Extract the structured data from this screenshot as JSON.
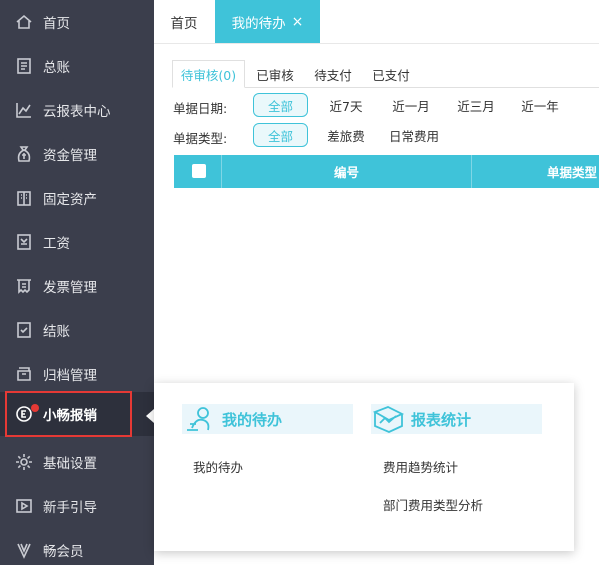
{
  "sidebar": {
    "items": [
      {
        "label": "首页",
        "icon": "home-icon"
      },
      {
        "label": "总账",
        "icon": "ledger-icon"
      },
      {
        "label": "云报表中心",
        "icon": "chart-icon"
      },
      {
        "label": "资金管理",
        "icon": "money-bag-icon"
      },
      {
        "label": "固定资产",
        "icon": "building-icon"
      },
      {
        "label": "工资",
        "icon": "salary-icon"
      },
      {
        "label": "发票管理",
        "icon": "invoice-icon"
      },
      {
        "label": "结账",
        "icon": "checkout-icon"
      },
      {
        "label": "归档管理",
        "icon": "archive-icon"
      },
      {
        "label": "小畅报销",
        "icon": "reimburse-icon"
      },
      {
        "label": "基础设置",
        "icon": "gear-icon"
      },
      {
        "label": "新手引导",
        "icon": "video-guide-icon"
      },
      {
        "label": "畅会员",
        "icon": "vip-icon"
      }
    ]
  },
  "topbar": {
    "home_tab": "首页",
    "todo_tab": "我的待办",
    "close_glyph": "×"
  },
  "subtabs": [
    "待审核(0)",
    "已审核",
    "待支付",
    "已支付"
  ],
  "filters": {
    "date_label": "单据日期:",
    "date_options": [
      "全部",
      "近7天",
      "近一月",
      "近三月",
      "近一年"
    ],
    "type_label": "单据类型:",
    "type_options": [
      "全部",
      "差旅费",
      "日常费用"
    ]
  },
  "table": {
    "headers": [
      "编号",
      "单据类型"
    ]
  },
  "popup": {
    "group1": {
      "title": "我的待办",
      "links": [
        "我的待办"
      ]
    },
    "group2": {
      "title": "报表统计",
      "links": [
        "费用趋势统计",
        "部门费用类型分析"
      ]
    }
  },
  "colors": {
    "accent": "#3fc3d9",
    "sidebar_bg": "#3b3e4c",
    "highlight_red": "#e53935"
  }
}
